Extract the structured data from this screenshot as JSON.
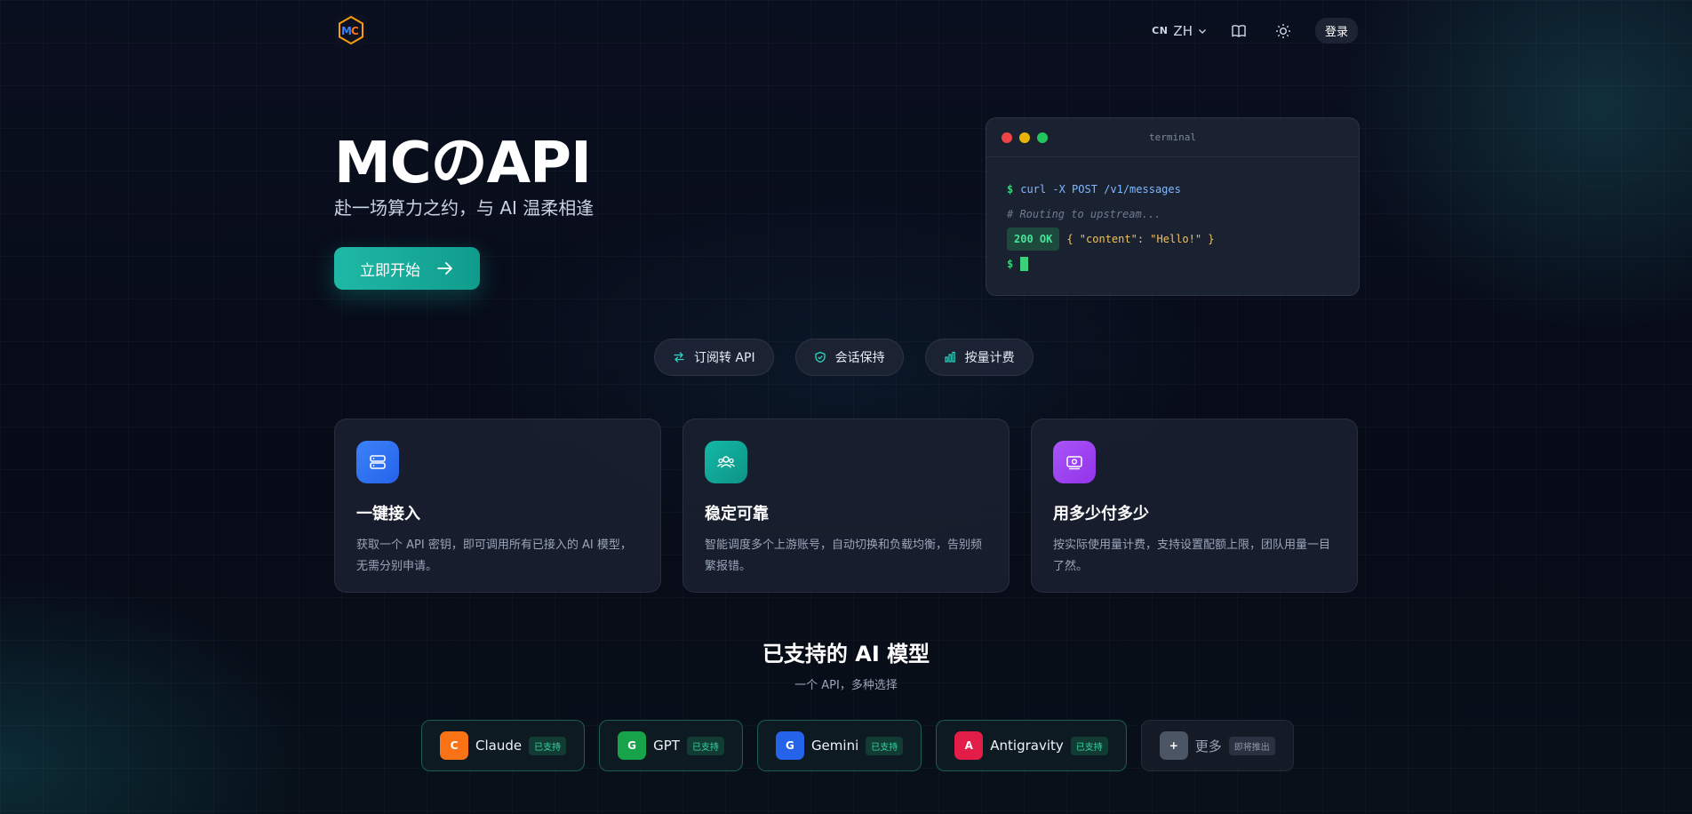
{
  "header": {
    "lang_prefix": "CN",
    "lang_label": "ZH",
    "login_label": "登录"
  },
  "hero": {
    "title": "MCのAPI",
    "subtitle": "赴一场算力之约，与 AI 温柔相逢",
    "cta_label": "立即开始"
  },
  "terminal": {
    "title": "terminal",
    "prompt": "$",
    "command": "curl -X POST /v1/messages",
    "comment": "# Routing to upstream...",
    "status": "200 OK",
    "response": "{ \"content\": \"Hello!\" }"
  },
  "features": [
    {
      "label": "订阅转 API",
      "icon": "swap-icon"
    },
    {
      "label": "会话保持",
      "icon": "shield-check-icon"
    },
    {
      "label": "按量计费",
      "icon": "bar-chart-icon"
    }
  ],
  "cards": [
    {
      "title": "一键接入",
      "desc": "获取一个 API 密钥，即可调用所有已接入的 AI 模型，无需分别申请。",
      "icon": "server-icon",
      "color_from": "#3b82f6",
      "color_to": "#2563eb"
    },
    {
      "title": "稳定可靠",
      "desc": "智能调度多个上游账号，自动切换和负载均衡，告别频繁报错。",
      "icon": "users-icon",
      "color_from": "#14b8a6",
      "color_to": "#0d9488"
    },
    {
      "title": "用多少付多少",
      "desc": "按实际使用量计费，支持设置配额上限，团队用量一目了然。",
      "icon": "money-icon",
      "color_from": "#a855f7",
      "color_to": "#9333ea"
    }
  ],
  "models_section": {
    "title": "已支持的 AI 模型",
    "subtitle": "一个 API，多种选择"
  },
  "models": [
    {
      "letter": "C",
      "name": "Claude",
      "badge": "已支持",
      "color": "#f97316"
    },
    {
      "letter": "G",
      "name": "GPT",
      "badge": "已支持",
      "color": "#16a34a"
    },
    {
      "letter": "G",
      "name": "Gemini",
      "badge": "已支持",
      "color": "#2563eb"
    },
    {
      "letter": "A",
      "name": "Antigravity",
      "badge": "已支持",
      "color": "#e11d48"
    },
    {
      "letter": "+",
      "name": "更多",
      "badge": "即将推出",
      "color": "#4b5563"
    }
  ],
  "colors": {
    "accent": "#14b8a6",
    "background": "#070b18"
  }
}
